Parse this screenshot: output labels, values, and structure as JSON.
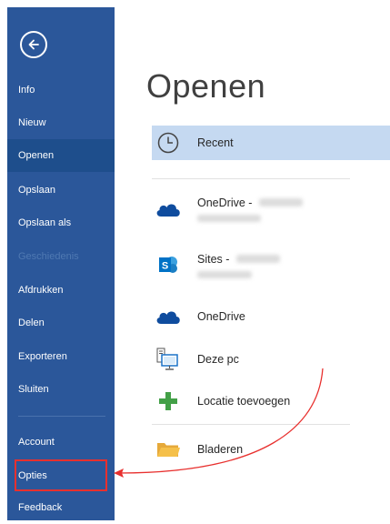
{
  "backstage": {
    "title": "Openen",
    "nav": {
      "info": "Info",
      "nieuw": "Nieuw",
      "openen": "Openen",
      "opslaan": "Opslaan",
      "opslaan_als": "Opslaan als",
      "geschiedenis": "Geschiedenis",
      "afdrukken": "Afdrukken",
      "delen": "Delen",
      "exporteren": "Exporteren",
      "sluiten": "Sluiten",
      "account": "Account",
      "opties": "Opties",
      "feedback": "Feedback"
    },
    "locations": {
      "recent": "Recent",
      "onedrive_business": "OneDrive -",
      "sites": "Sites -",
      "onedrive": "OneDrive",
      "deze_pc": "Deze pc",
      "locatie_toevoegen": "Locatie toevoegen",
      "bladeren": "Bladeren"
    }
  },
  "colors": {
    "sidebar": "#2b579a",
    "sidebar_selected": "#1e4e8c",
    "recent_highlight": "#c5d9f1",
    "annotation_red": "#e8302e",
    "onedrive_blue": "#0f4c9e",
    "sharepoint_blue": "#0072c6",
    "add_green": "#43a047",
    "folder_yellow": "#f5c04a"
  }
}
